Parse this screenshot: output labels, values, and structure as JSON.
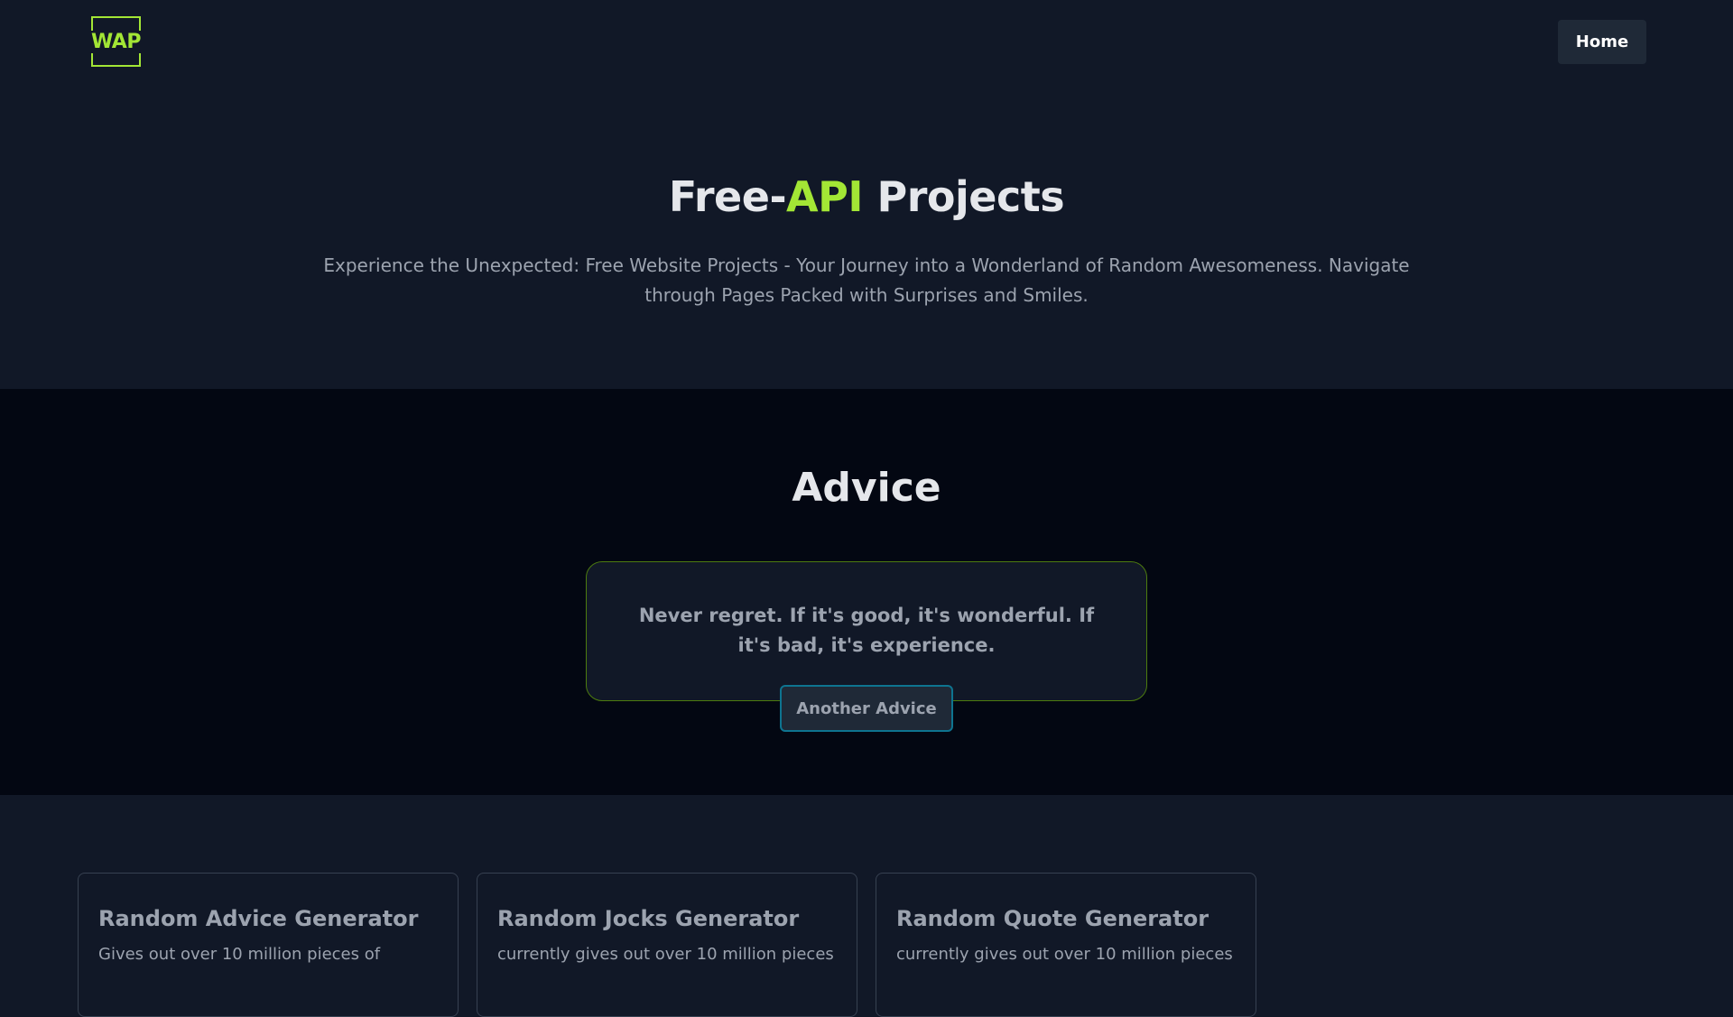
{
  "header": {
    "logo_text": "WAP",
    "nav": {
      "home_label": "Home"
    }
  },
  "hero": {
    "title_prefix": "Free-",
    "title_accent": "API",
    "title_suffix": " Projects",
    "description": "Experience the Unexpected: Free Website Projects - Your Journey into a Wonderland of Random Awesomeness. Navigate through Pages Packed with Surprises and Smiles."
  },
  "advice": {
    "heading": "Advice",
    "quote": "Never regret. If it's good, it's wonderful. If it's bad, it's experience.",
    "button_label": "Another Advice"
  },
  "projects": [
    {
      "title": "Random Advice Generator",
      "description": "Gives out over 10 million pieces of"
    },
    {
      "title": "Random Jocks Generator",
      "description": "currently gives out over 10 million pieces"
    },
    {
      "title": "Random Quote Generator",
      "description": "currently gives out over 10 million pieces"
    }
  ],
  "colors": {
    "background": "#111827",
    "section_dark": "#030712",
    "accent": "#a3e635",
    "button_border": "#0e7490"
  }
}
